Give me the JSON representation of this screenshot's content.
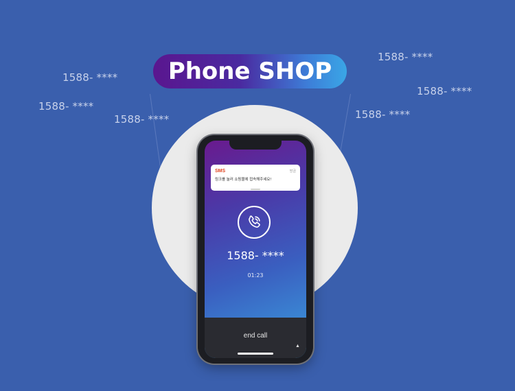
{
  "banner": {
    "title": "Phone SHOP"
  },
  "floating_numbers": [
    "1588- ****",
    "1588- ****",
    "1588- ****",
    "1588- ****",
    "1588- ****",
    "1588- ****"
  ],
  "phone": {
    "notification": {
      "title": "SMS",
      "time": "방금",
      "message": "링크를 눌러 쇼핑몰에 접속해주세요!"
    },
    "call": {
      "number": "1588- ****",
      "timer": "01:23",
      "end_label": "end call"
    }
  },
  "colors": {
    "background": "#3a5fad",
    "circle": "#ebebeb",
    "sms_title": "#e0431f"
  }
}
